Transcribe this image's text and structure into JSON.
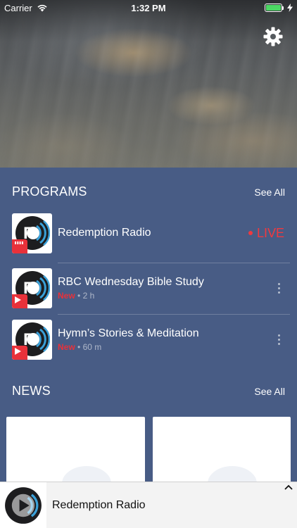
{
  "status_bar": {
    "carrier": "Carrier",
    "time": "1:32 PM",
    "battery_level": 1.0
  },
  "header": {
    "settings_icon": "gear-icon"
  },
  "programs": {
    "title": "PROGRAMS",
    "see_all": "See All",
    "items": [
      {
        "title": "Redemption Radio",
        "live_label": "LIVE",
        "new_label": "",
        "duration": ""
      },
      {
        "title": "RBC Wednesday Bible Study",
        "live_label": "",
        "new_label": "New",
        "duration": "2 h"
      },
      {
        "title": "Hymn’s Stories & Meditation",
        "live_label": "",
        "new_label": "New",
        "duration": "60 m"
      }
    ]
  },
  "news": {
    "title": "NEWS",
    "see_all": "See All"
  },
  "mini_player": {
    "title": "Redemption Radio"
  },
  "colors": {
    "background": "#485c85",
    "live": "#f0393f",
    "badge": "#e8313a",
    "battery": "#4cd964"
  }
}
